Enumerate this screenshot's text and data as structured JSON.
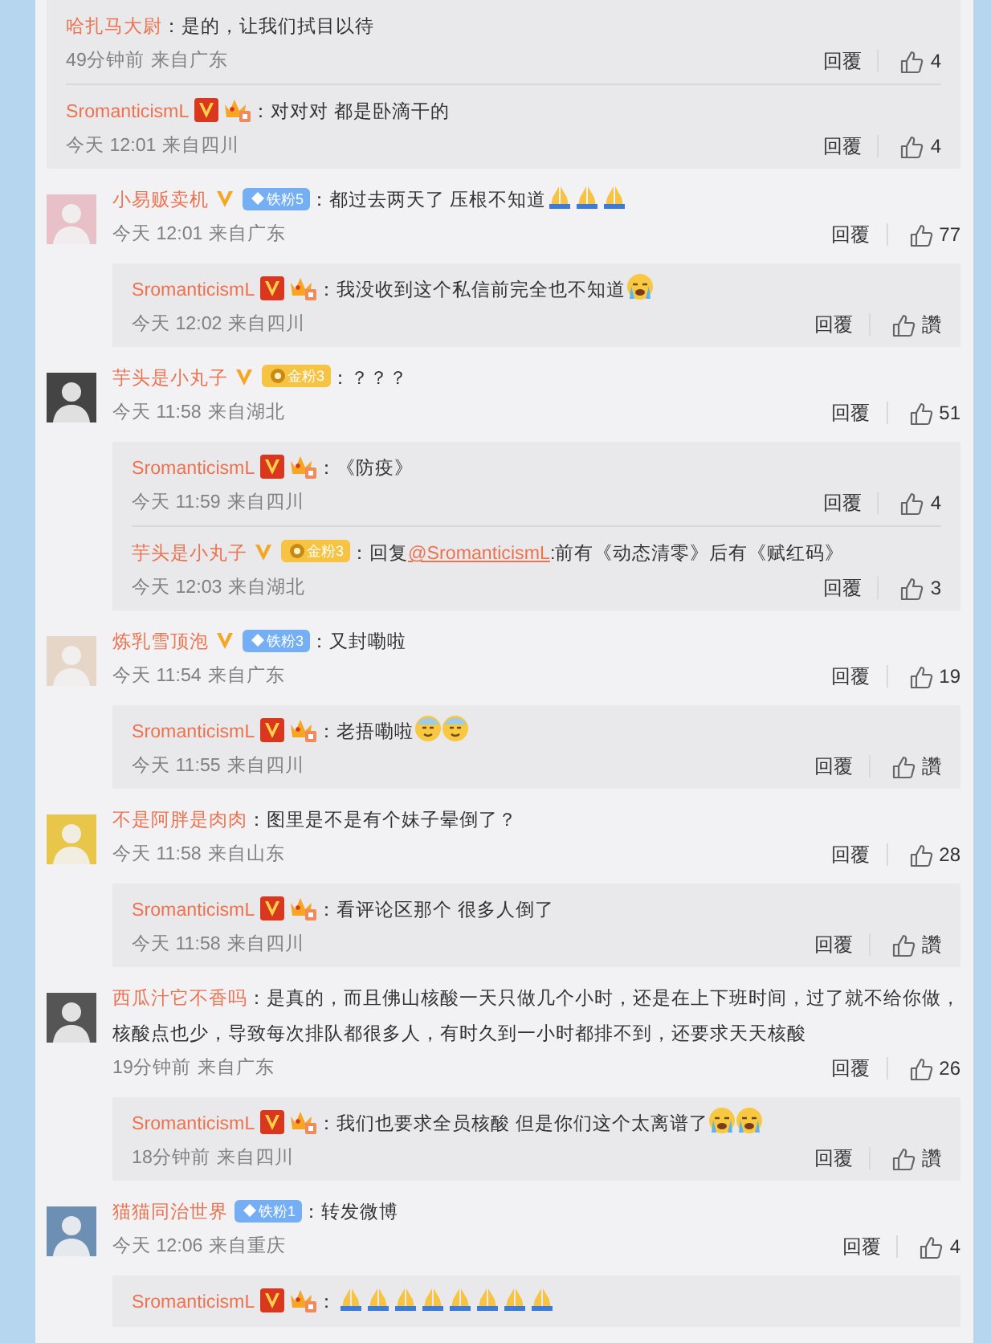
{
  "threads": [
    {
      "replies": [
        {
          "user": "哈扎马大尉",
          "content": [
            {
              "kind": "text",
              "text": "：是的，让我们拭目以待"
            }
          ],
          "time": "49分钟前",
          "location": "来自广东",
          "reply_label": "回覆",
          "likes": "4"
        },
        {
          "user": "SromanticismL",
          "verified": true,
          "vip": true,
          "content": [
            {
              "kind": "text",
              "text": "：对对对 都是卧滴干的"
            }
          ],
          "time": "今天 12:01",
          "location": "来自四川",
          "reply_label": "回覆",
          "likes": "4"
        }
      ]
    },
    {
      "comment": {
        "user": "小易贩卖机",
        "verified": true,
        "fan_badge": {
          "kind": "iron",
          "label": "铁粉5"
        },
        "content": [
          {
            "kind": "text",
            "text": "：都过去两天了 压根不知道"
          },
          {
            "kind": "pray"
          },
          {
            "kind": "pray"
          },
          {
            "kind": "pray"
          }
        ],
        "time": "今天 12:01",
        "location": "来自广东",
        "reply_label": "回覆",
        "likes": "77"
      },
      "replies": [
        {
          "user": "SromanticismL",
          "verified": true,
          "vip": true,
          "content": [
            {
              "kind": "text",
              "text": "：我没收到这个私信前完全也不知道"
            },
            {
              "kind": "cry"
            }
          ],
          "time": "今天 12:02",
          "location": "来自四川",
          "reply_label": "回覆",
          "likes": "讚"
        }
      ]
    },
    {
      "comment": {
        "user": "芋头是小丸子",
        "verified": true,
        "fan_badge": {
          "kind": "gold",
          "label": "金粉3"
        },
        "content": [
          {
            "kind": "text",
            "text": "：？？？"
          }
        ],
        "time": "今天 11:58",
        "location": "来自湖北",
        "reply_label": "回覆",
        "likes": "51"
      },
      "replies": [
        {
          "user": "SromanticismL",
          "verified": true,
          "vip": true,
          "content": [
            {
              "kind": "text",
              "text": "：《防疫》"
            }
          ],
          "time": "今天 11:59",
          "location": "来自四川",
          "reply_label": "回覆",
          "likes": "4"
        },
        {
          "user": "芋头是小丸子",
          "verified": true,
          "fan_badge": {
            "kind": "gold",
            "label": "金粉3"
          },
          "content": [
            {
              "kind": "text",
              "text": "：回复"
            },
            {
              "kind": "mention",
              "text": "@SromanticismL"
            },
            {
              "kind": "text",
              "text": ":前有《动态清零》后有《赋红码》"
            }
          ],
          "time": "今天 12:03",
          "location": "来自湖北",
          "reply_label": "回覆",
          "likes": "3"
        }
      ]
    },
    {
      "comment": {
        "user": "炼乳雪顶泡",
        "verified": true,
        "fan_badge": {
          "kind": "iron",
          "label": "铁粉3"
        },
        "content": [
          {
            "kind": "text",
            "text": "：又封嘞啦"
          }
        ],
        "time": "今天 11:54",
        "location": "来自广东",
        "reply_label": "回覆",
        "likes": "19"
      },
      "replies": [
        {
          "user": "SromanticismL",
          "verified": true,
          "vip": true,
          "content": [
            {
              "kind": "text",
              "text": "：老捂嘞啦"
            },
            {
              "kind": "sweat"
            },
            {
              "kind": "sweat"
            }
          ],
          "time": "今天 11:55",
          "location": "来自四川",
          "reply_label": "回覆",
          "likes": "讚"
        }
      ]
    },
    {
      "comment": {
        "user": "不是阿胖是肉肉",
        "content": [
          {
            "kind": "text",
            "text": "：图里是不是有个妹子晕倒了？"
          }
        ],
        "time": "今天 11:58",
        "location": "来自山东",
        "reply_label": "回覆",
        "likes": "28"
      },
      "replies": [
        {
          "user": "SromanticismL",
          "verified": true,
          "vip": true,
          "content": [
            {
              "kind": "text",
              "text": "：看评论区那个 很多人倒了"
            }
          ],
          "time": "今天 11:58",
          "location": "来自四川",
          "reply_label": "回覆",
          "likes": "讚"
        }
      ]
    },
    {
      "comment": {
        "user": "西瓜汁它不香吗",
        "content": [
          {
            "kind": "text",
            "text": "：是真的，而且佛山核酸一天只做几个小时，还是在上下班时间，过了就不给你做，核酸点也少，导致每次排队都很多人，有时久到一小时都排不到，还要求天天核酸"
          }
        ],
        "time": "19分钟前",
        "location": "来自广东",
        "reply_label": "回覆",
        "likes": "26"
      },
      "replies": [
        {
          "user": "SromanticismL",
          "verified": true,
          "vip": true,
          "content": [
            {
              "kind": "text",
              "text": "：我们也要求全员核酸 但是你们这个太离谱了"
            },
            {
              "kind": "cry"
            },
            {
              "kind": "cry"
            }
          ],
          "time": "18分钟前",
          "location": "来自四川",
          "reply_label": "回覆",
          "likes": "讚"
        }
      ]
    },
    {
      "comment": {
        "user": "猫猫同治世界",
        "fan_badge": {
          "kind": "iron",
          "label": "铁粉1"
        },
        "content": [
          {
            "kind": "text",
            "text": "：转发微博"
          }
        ],
        "time": "今天 12:06",
        "location": "来自重庆",
        "reply_label": "回覆",
        "likes": "4"
      },
      "replies": [
        {
          "user": "SromanticismL",
          "verified": true,
          "vip": true,
          "content": [
            {
              "kind": "text",
              "text": "："
            },
            {
              "kind": "pray"
            },
            {
              "kind": "pray"
            },
            {
              "kind": "pray"
            },
            {
              "kind": "pray"
            },
            {
              "kind": "pray"
            },
            {
              "kind": "pray"
            },
            {
              "kind": "pray"
            },
            {
              "kind": "pray"
            }
          ]
        }
      ]
    }
  ]
}
